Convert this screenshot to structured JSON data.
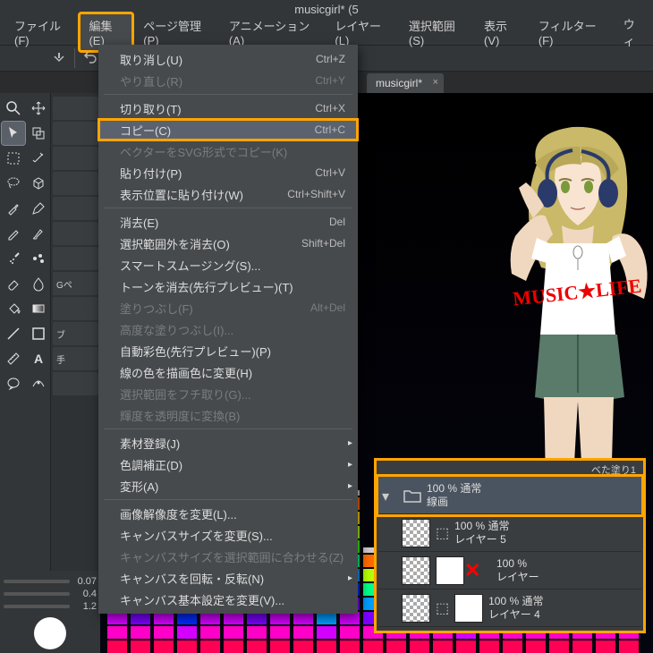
{
  "title": "musicgirl* (5",
  "menubar": {
    "file": "ファイル(F)",
    "edit": "編集(E)",
    "page": "ページ管理(P)",
    "anim": "アニメーション(A)",
    "layer": "レイヤー(L)",
    "select": "選択範囲(S)",
    "view": "表示(V)",
    "filter": "フィルター(F)",
    "window": "ウィ"
  },
  "tab": {
    "name": "musicgirl*"
  },
  "edit_menu": {
    "undo": {
      "label": "取り消し(U)",
      "shortcut": "Ctrl+Z"
    },
    "redo": {
      "label": "やり直し(R)",
      "shortcut": "Ctrl+Y"
    },
    "cut": {
      "label": "切り取り(T)",
      "shortcut": "Ctrl+X"
    },
    "copy": {
      "label": "コピー(C)",
      "shortcut": "Ctrl+C"
    },
    "copy_svg": {
      "label": "ベクターをSVG形式でコピー(K)",
      "shortcut": ""
    },
    "paste": {
      "label": "貼り付け(P)",
      "shortcut": "Ctrl+V"
    },
    "paste_pos": {
      "label": "表示位置に貼り付け(W)",
      "shortcut": "Ctrl+Shift+V"
    },
    "clear": {
      "label": "消去(E)",
      "shortcut": "Del"
    },
    "clear_outside": {
      "label": "選択範囲外を消去(O)",
      "shortcut": "Shift+Del"
    },
    "smart_smooth": {
      "label": "スマートスムージング(S)...",
      "shortcut": ""
    },
    "remove_tone": {
      "label": "トーンを消去(先行プレビュー)(T)",
      "shortcut": ""
    },
    "fill": {
      "label": "塗りつぶし(F)",
      "shortcut": "Alt+Del"
    },
    "adv_fill": {
      "label": "高度な塗りつぶし(I)...",
      "shortcut": ""
    },
    "auto_color": {
      "label": "自動彩色(先行プレビュー)(P)",
      "shortcut": ""
    },
    "line_to_draw": {
      "label": "線の色を描画色に変更(H)",
      "shortcut": ""
    },
    "sel_border": {
      "label": "選択範囲をフチ取り(G)...",
      "shortcut": ""
    },
    "bright_opacity": {
      "label": "輝度を透明度に変換(B)",
      "shortcut": ""
    },
    "material": {
      "label": "素材登録(J)",
      "shortcut": ""
    },
    "color_adjust": {
      "label": "色調補正(D)",
      "shortcut": ""
    },
    "transform": {
      "label": "変形(A)",
      "shortcut": ""
    },
    "img_res": {
      "label": "画像解像度を変更(L)...",
      "shortcut": ""
    },
    "canvas_size": {
      "label": "キャンバスサイズを変更(S)...",
      "shortcut": ""
    },
    "canvas_sel": {
      "label": "キャンバスサイズを選択範囲に合わせる(Z)",
      "shortcut": ""
    },
    "canvas_rotate": {
      "label": "キャンバスを回転・反転(N)",
      "shortcut": ""
    },
    "canvas_settings": {
      "label": "キャンバス基本設定を変更(V)...",
      "shortcut": ""
    }
  },
  "sub_panel": {
    "gpen": "Gペ",
    "brush": "ブ",
    "hand": "手"
  },
  "brush": {
    "val1": "0.07",
    "val2": "0.4",
    "val3": "1.2"
  },
  "layers": {
    "top_cut": "ベた塗り1",
    "linework": {
      "opacity": "100 % 通常",
      "name": "線画"
    },
    "layer5": {
      "opacity": "100 % 通常",
      "name": "レイヤー 5"
    },
    "disabled": {
      "opacity": "100 %",
      "name": "レイヤー"
    },
    "layer4": {
      "opacity": "100 % 通常",
      "name": "レイヤー 4"
    }
  },
  "eq_colors": [
    "#ff1a1a",
    "#ff6a00",
    "#ffd400",
    "#b6ff00",
    "#38ff00",
    "#00ff88",
    "#00fff2",
    "#009dff",
    "#002bff",
    "#7a00ff",
    "#d400ff",
    "#ff00c8",
    "#ff0055"
  ],
  "girl_shirt": "MUSIC★LIFE"
}
